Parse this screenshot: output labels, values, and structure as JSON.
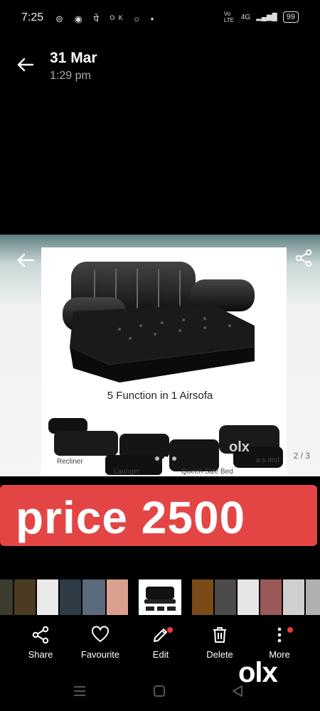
{
  "status_bar": {
    "time": "7:25",
    "network": "4G",
    "volte": "Vo LTE",
    "battery": "99"
  },
  "header": {
    "date": "31 Mar",
    "time": "1:29 pm"
  },
  "photo": {
    "title": "5 Function in 1 Airsofa",
    "captions": [
      "Recliner",
      "Launger",
      "Queen Size Bed",
      "a s ded"
    ],
    "page_indicator": "2 / 3",
    "watermark": "olx"
  },
  "price_banner": {
    "text": "price 2500",
    "color": "#e34545"
  },
  "actions": [
    {
      "label": "Share",
      "icon": "share-icon"
    },
    {
      "label": "Favourite",
      "icon": "heart-icon"
    },
    {
      "label": "Edit",
      "icon": "edit-icon",
      "badge": true
    },
    {
      "label": "Delete",
      "icon": "trash-icon"
    },
    {
      "label": "More",
      "icon": "more-vertical-icon",
      "badge": true
    }
  ],
  "watermark": "olx",
  "nav": [
    "recents-icon",
    "home-icon",
    "back-icon"
  ]
}
